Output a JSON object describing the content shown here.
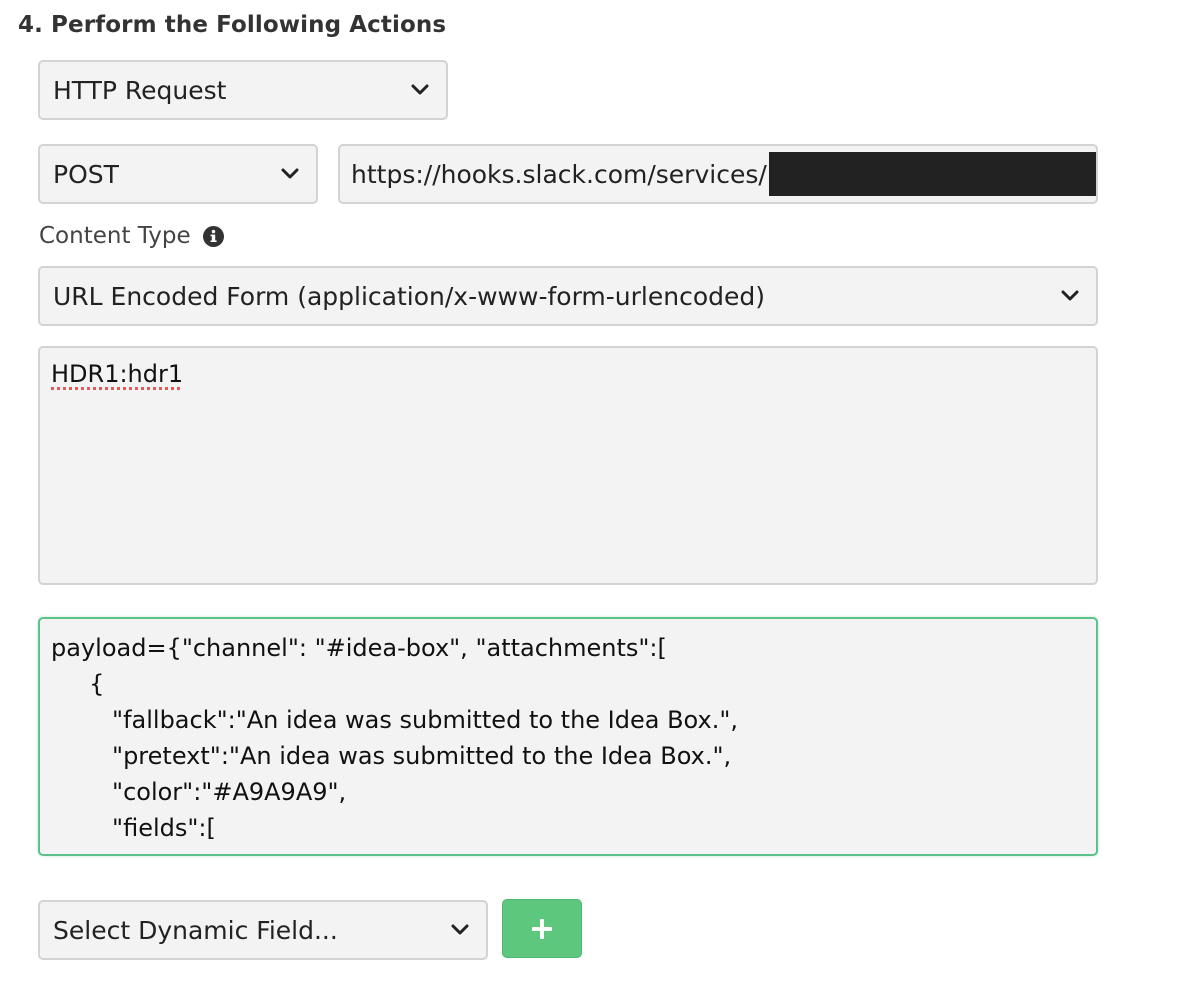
{
  "section": {
    "title": "4. Perform the Following Actions"
  },
  "action_select": {
    "value": "HTTP Request",
    "icon": "chevron-down-icon"
  },
  "method_select": {
    "value": "POST",
    "icon": "chevron-down-icon"
  },
  "url_input": {
    "value": "https://hooks.slack.com/services/"
  },
  "content_type": {
    "label": "Content Type",
    "info_icon": "info-circle-icon",
    "value": "URL Encoded Form (application/x-www-form-urlencoded)"
  },
  "headers_textarea": {
    "value": "HDR1:hdr1"
  },
  "body_textarea": {
    "lines": [
      "payload={\"channel\": \"#idea-box\", \"attachments\":[",
      "     {",
      "        \"fallback\":\"An idea was submitted to the Idea Box.\",",
      "        \"pretext\":\"An idea was submitted to the Idea Box.\",",
      "        \"color\":\"#A9A9A9\",",
      "        \"fields\":["
    ]
  },
  "dynamic_field_select": {
    "value": "Select Dynamic Field...",
    "icon": "chevron-down-icon"
  },
  "add_button": {
    "icon": "plus-icon",
    "color": "#5dc77e"
  }
}
